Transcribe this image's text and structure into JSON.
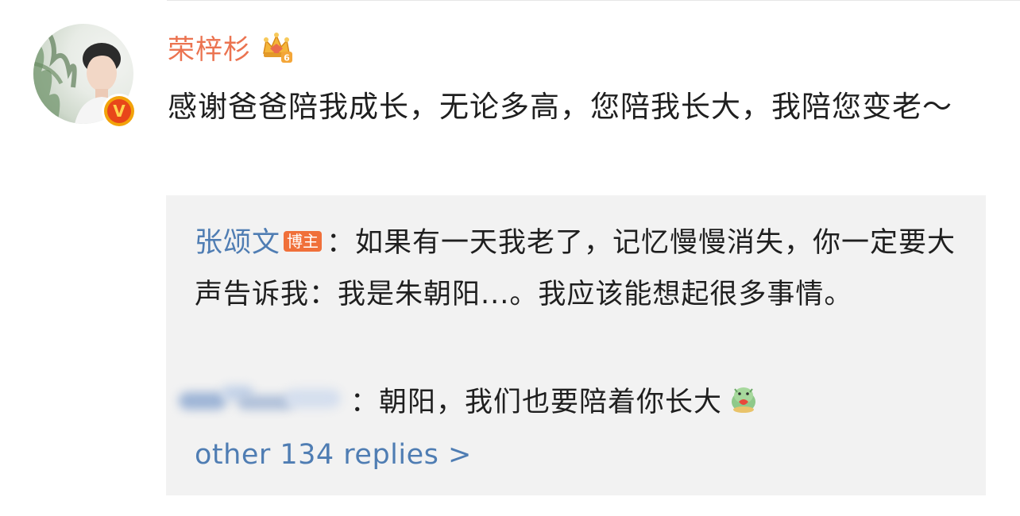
{
  "post": {
    "username": "荣梓杉",
    "text": "感谢爸爸陪我成长，无论多高，您陪我长大，我陪您变老～",
    "level_badge": "6",
    "verified_mark": "V"
  },
  "replies": {
    "first": {
      "author": "张颂文",
      "badge": "博主",
      "text": "：如果有一天我老了，记忆慢慢消失，你一定要大声告诉我：我是朱朝阳...。我应该能想起很多事情。"
    },
    "second": {
      "text": "：朝阳，我们也要陪着你长大"
    },
    "more_link": "other 134 replies >"
  },
  "colors": {
    "username": "#eb7350",
    "link": "#4f7db3",
    "text": "#1f1f1f",
    "reply_bg": "#f2f2f2",
    "badge": "#f0703a"
  },
  "icons": {
    "crown": "crown-level-icon",
    "verified": "verified-badge-icon",
    "emoji": "dragon-hug-emoji-icon"
  }
}
